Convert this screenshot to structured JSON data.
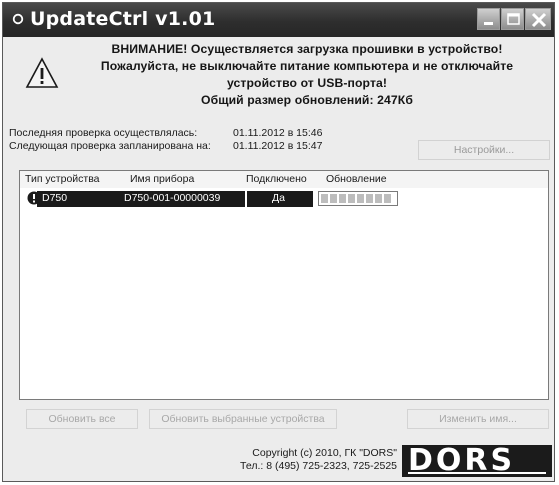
{
  "window": {
    "title": "UpdateCtrl v1.01"
  },
  "warning": {
    "lines": [
      "ВНИМАНИЕ! Осуществляется загрузка прошивки в устройство!",
      "Пожалуйста, не выключайте питание компьютера и не отключайте",
      "устройство от USB-порта!",
      "Общий размер обновлений: 247Кб"
    ]
  },
  "check": {
    "last_label": "Последняя проверка осуществлялась:",
    "last_value": "01.11.2012 в 15:46",
    "next_label": "Следующая проверка запланирована на:",
    "next_value": "01.11.2012 в 15:47",
    "settings_button": "Настройки..."
  },
  "device_list": {
    "columns": [
      "Тип устройства",
      "Имя прибора",
      "Подключено",
      "Обновление"
    ],
    "rows": [
      {
        "type": "D750",
        "name": "D750-001-00000039",
        "connected": "Да",
        "status_icon": "info-icon",
        "update_progress": 1.0
      }
    ]
  },
  "buttons": {
    "update_all": "Обновить все",
    "update_selected": "Обновить выбранные устройства",
    "change": "Изменить имя..."
  },
  "footer": {
    "copyright_line1": "Copyright (c) 2010, ГК \"DORS\"",
    "copyright_line2": "Тел.: 8 (495) 725-2323, 725-2525",
    "logo_text": "DORS"
  },
  "colors": {
    "titlebar": "#2e2e2e",
    "row_highlight": "#1a1a1a"
  }
}
